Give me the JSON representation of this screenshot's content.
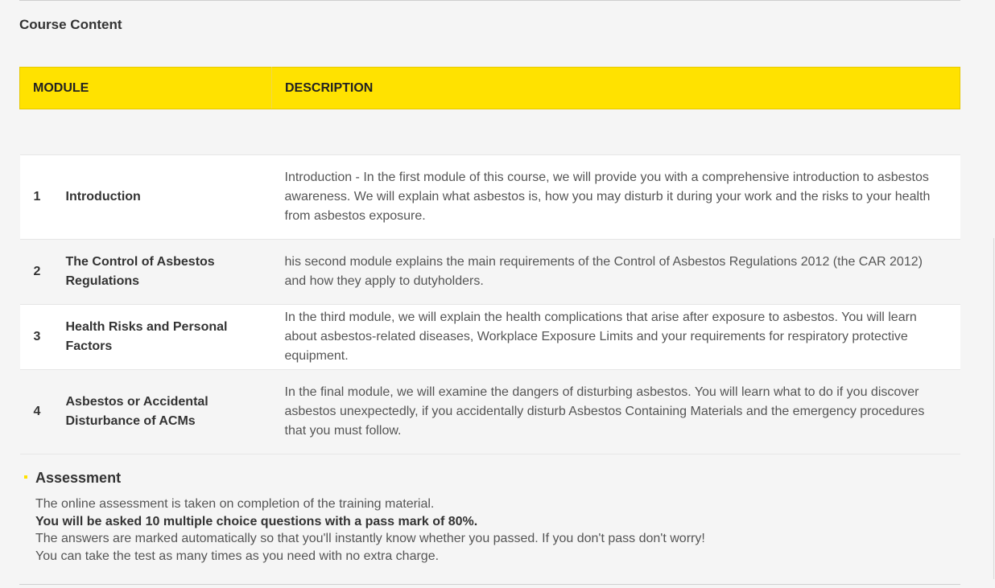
{
  "section_title": "Course Content",
  "table": {
    "headers": {
      "module": "MODULE",
      "description": "DESCRIPTION"
    },
    "rows": [
      {
        "number": "1",
        "name": "Introduction",
        "description": "Introduction - In the first module of this course, we will provide you with a comprehensive introduction to asbestos awareness. We will explain what asbestos is, how you may disturb it during your work and the risks to your health from asbestos exposure."
      },
      {
        "number": "2",
        "name": "The Control of Asbestos Regulations",
        "description": "his second module explains the main requirements of the Control of Asbestos Regulations 2012 (the CAR 2012) and how they apply to dutyholders."
      },
      {
        "number": "3",
        "name": "Health Risks and Personal Factors",
        "description": "In the third module, we will explain the health complications that arise after exposure to asbestos. You will learn about asbestos-related diseases, Workplace Exposure Limits and your requirements for respiratory protective equipment."
      },
      {
        "number": "4",
        "name": "Asbestos or Accidental Disturbance of ACMs",
        "description": "In the final module, we will examine the dangers of disturbing asbestos. You will learn what to do if you discover asbestos unexpectedly, if you accidentally disturb Asbestos Containing Materials and the emergency procedures that you must follow."
      }
    ]
  },
  "assessment": {
    "title": "Assessment",
    "line1": "The online assessment is taken on completion of the training material.",
    "line2": "You will be asked 10 multiple choice questions with a pass mark of 80%.",
    "line3": "The answers are marked automatically so that you'll instantly know whether you passed. If you don't pass don't worry!",
    "line4": "You can take the test as many times as you need with no extra charge."
  },
  "colors": {
    "header_yellow": "#ffe200",
    "background": "#f5f5f5",
    "row_white": "#ffffff"
  }
}
